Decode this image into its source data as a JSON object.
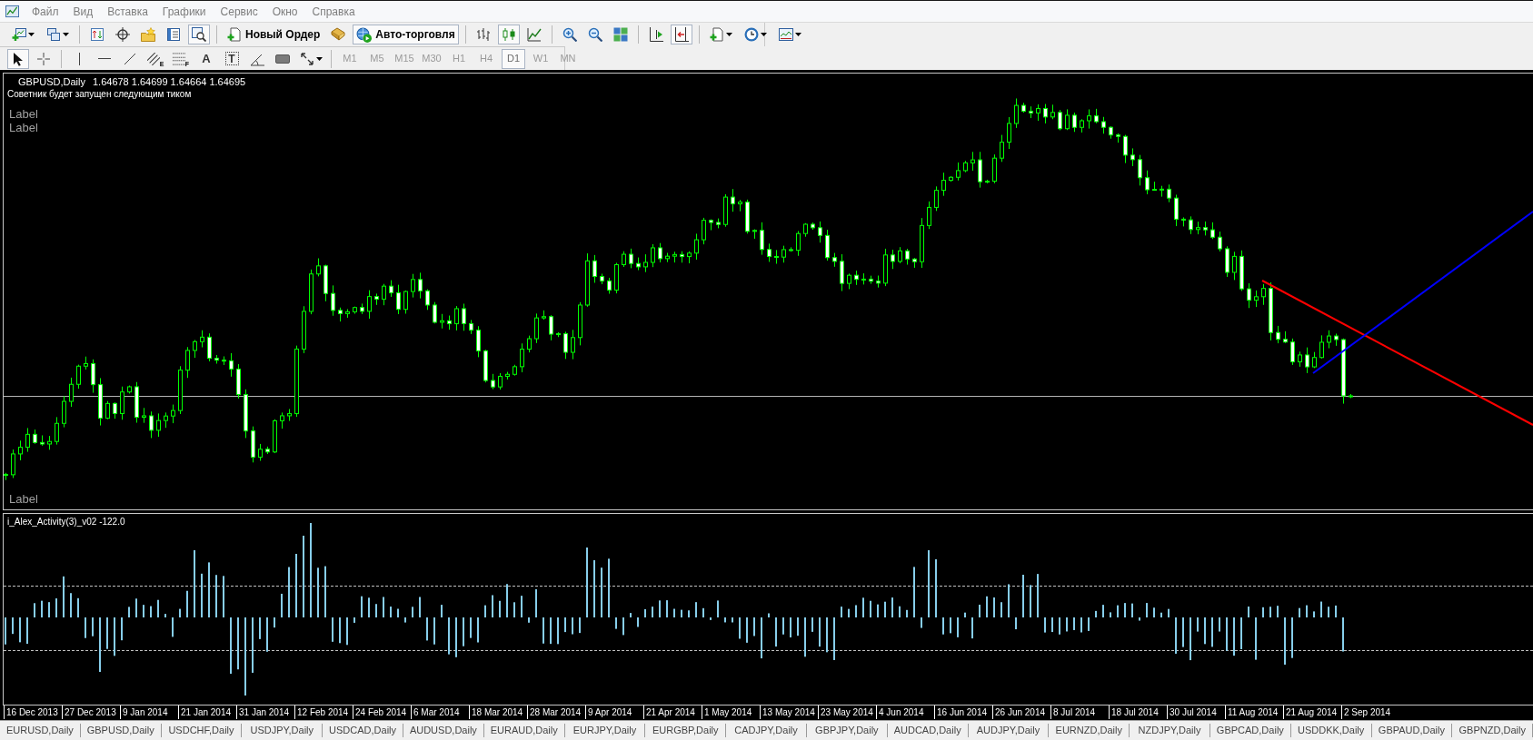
{
  "menu": [
    "Файл",
    "Вид",
    "Вставка",
    "Графики",
    "Сервис",
    "Окно",
    "Справка"
  ],
  "standard_toolbar": {
    "strategy_tester": {
      "on": true
    },
    "new_order": "Новый Ордер",
    "auto_trading": {
      "label": "Авто-торговля",
      "on": true
    },
    "chart_types": [
      {
        "kind": "bars",
        "selected": false
      },
      {
        "kind": "candles",
        "selected": true
      },
      {
        "kind": "line",
        "selected": false
      }
    ],
    "chart_shift": {
      "on": false
    },
    "autoscroll": {
      "on": true
    }
  },
  "drawing_toolbar": {
    "tools": [
      {
        "kind": "cursor",
        "selected": true
      },
      {
        "kind": "crosshair",
        "selected": false
      },
      {
        "kind": "vertical-line",
        "selected": false
      },
      {
        "kind": "horizontal-line",
        "selected": false
      },
      {
        "kind": "trendline",
        "selected": false
      },
      {
        "kind": "channel",
        "glyph": "E",
        "selected": false
      },
      {
        "kind": "fibonacci",
        "glyph": "F",
        "selected": false
      },
      {
        "kind": "text",
        "glyph": "A",
        "selected": false
      },
      {
        "kind": "text-label",
        "glyph": "T",
        "selected": false
      },
      {
        "kind": "angle",
        "selected": false
      },
      {
        "kind": "rectangle",
        "selected": false
      },
      {
        "kind": "arrows",
        "selected": false
      }
    ],
    "periods": [
      {
        "label": "M1",
        "selected": false
      },
      {
        "label": "M5",
        "selected": false
      },
      {
        "label": "M15",
        "selected": false
      },
      {
        "label": "M30",
        "selected": false
      },
      {
        "label": "H1",
        "selected": false
      },
      {
        "label": "H4",
        "selected": false
      },
      {
        "label": "D1",
        "selected": true
      },
      {
        "label": "W1",
        "selected": false
      },
      {
        "label": "MN",
        "selected": false
      }
    ]
  },
  "chart": {
    "symbol": "GBPUSD,Daily",
    "ohlc": "1.64678 1.64699 1.64664 1.64695",
    "status": "Советник будет запущен следующим тиком",
    "labels": [
      "Label",
      "Label"
    ],
    "bottom_label": "Label",
    "trendlines": [
      {
        "color": "#ff0000"
      },
      {
        "color": "#0000ff"
      }
    ]
  },
  "indicator": {
    "title": "i_Alex_Activity(3)_v02 -122.0"
  },
  "time_axis": [
    "16 Dec 2013",
    "27 Dec 2013",
    "9 Jan 2014",
    "21 Jan 2014",
    "31 Jan 2014",
    "12 Feb 2014",
    "24 Feb 2014",
    "6 Mar 2014",
    "18 Mar 2014",
    "28 Mar 2014",
    "9 Apr 2014",
    "21 Apr 2014",
    "1 May 2014",
    "13 May 2014",
    "23 May 2014",
    "4 Jun 2014",
    "16 Jun 2014",
    "26 Jun 2014",
    "8 Jul 2014",
    "18 Jul 2014",
    "30 Jul 2014",
    "11 Aug 2014",
    "21 Aug 2014",
    "2 Sep 2014"
  ],
  "tabs": [
    "EURUSD,Daily",
    "GBPUSD,Daily",
    "USDCHF,Daily",
    "USDJPY,Daily",
    "USDCAD,Daily",
    "AUDUSD,Daily",
    "EURAUD,Daily",
    "EURJPY,Daily",
    "EURGBP,Daily",
    "CADJPY,Daily",
    "GBPJPY,Daily",
    "AUDCAD,Daily",
    "AUDJPY,Daily",
    "EURNZD,Daily",
    "NZDJPY,Daily",
    "GBPCAD,Daily",
    "USDDKK,Daily",
    "GBPAUD,Daily",
    "GBPNZD,Daily"
  ]
}
